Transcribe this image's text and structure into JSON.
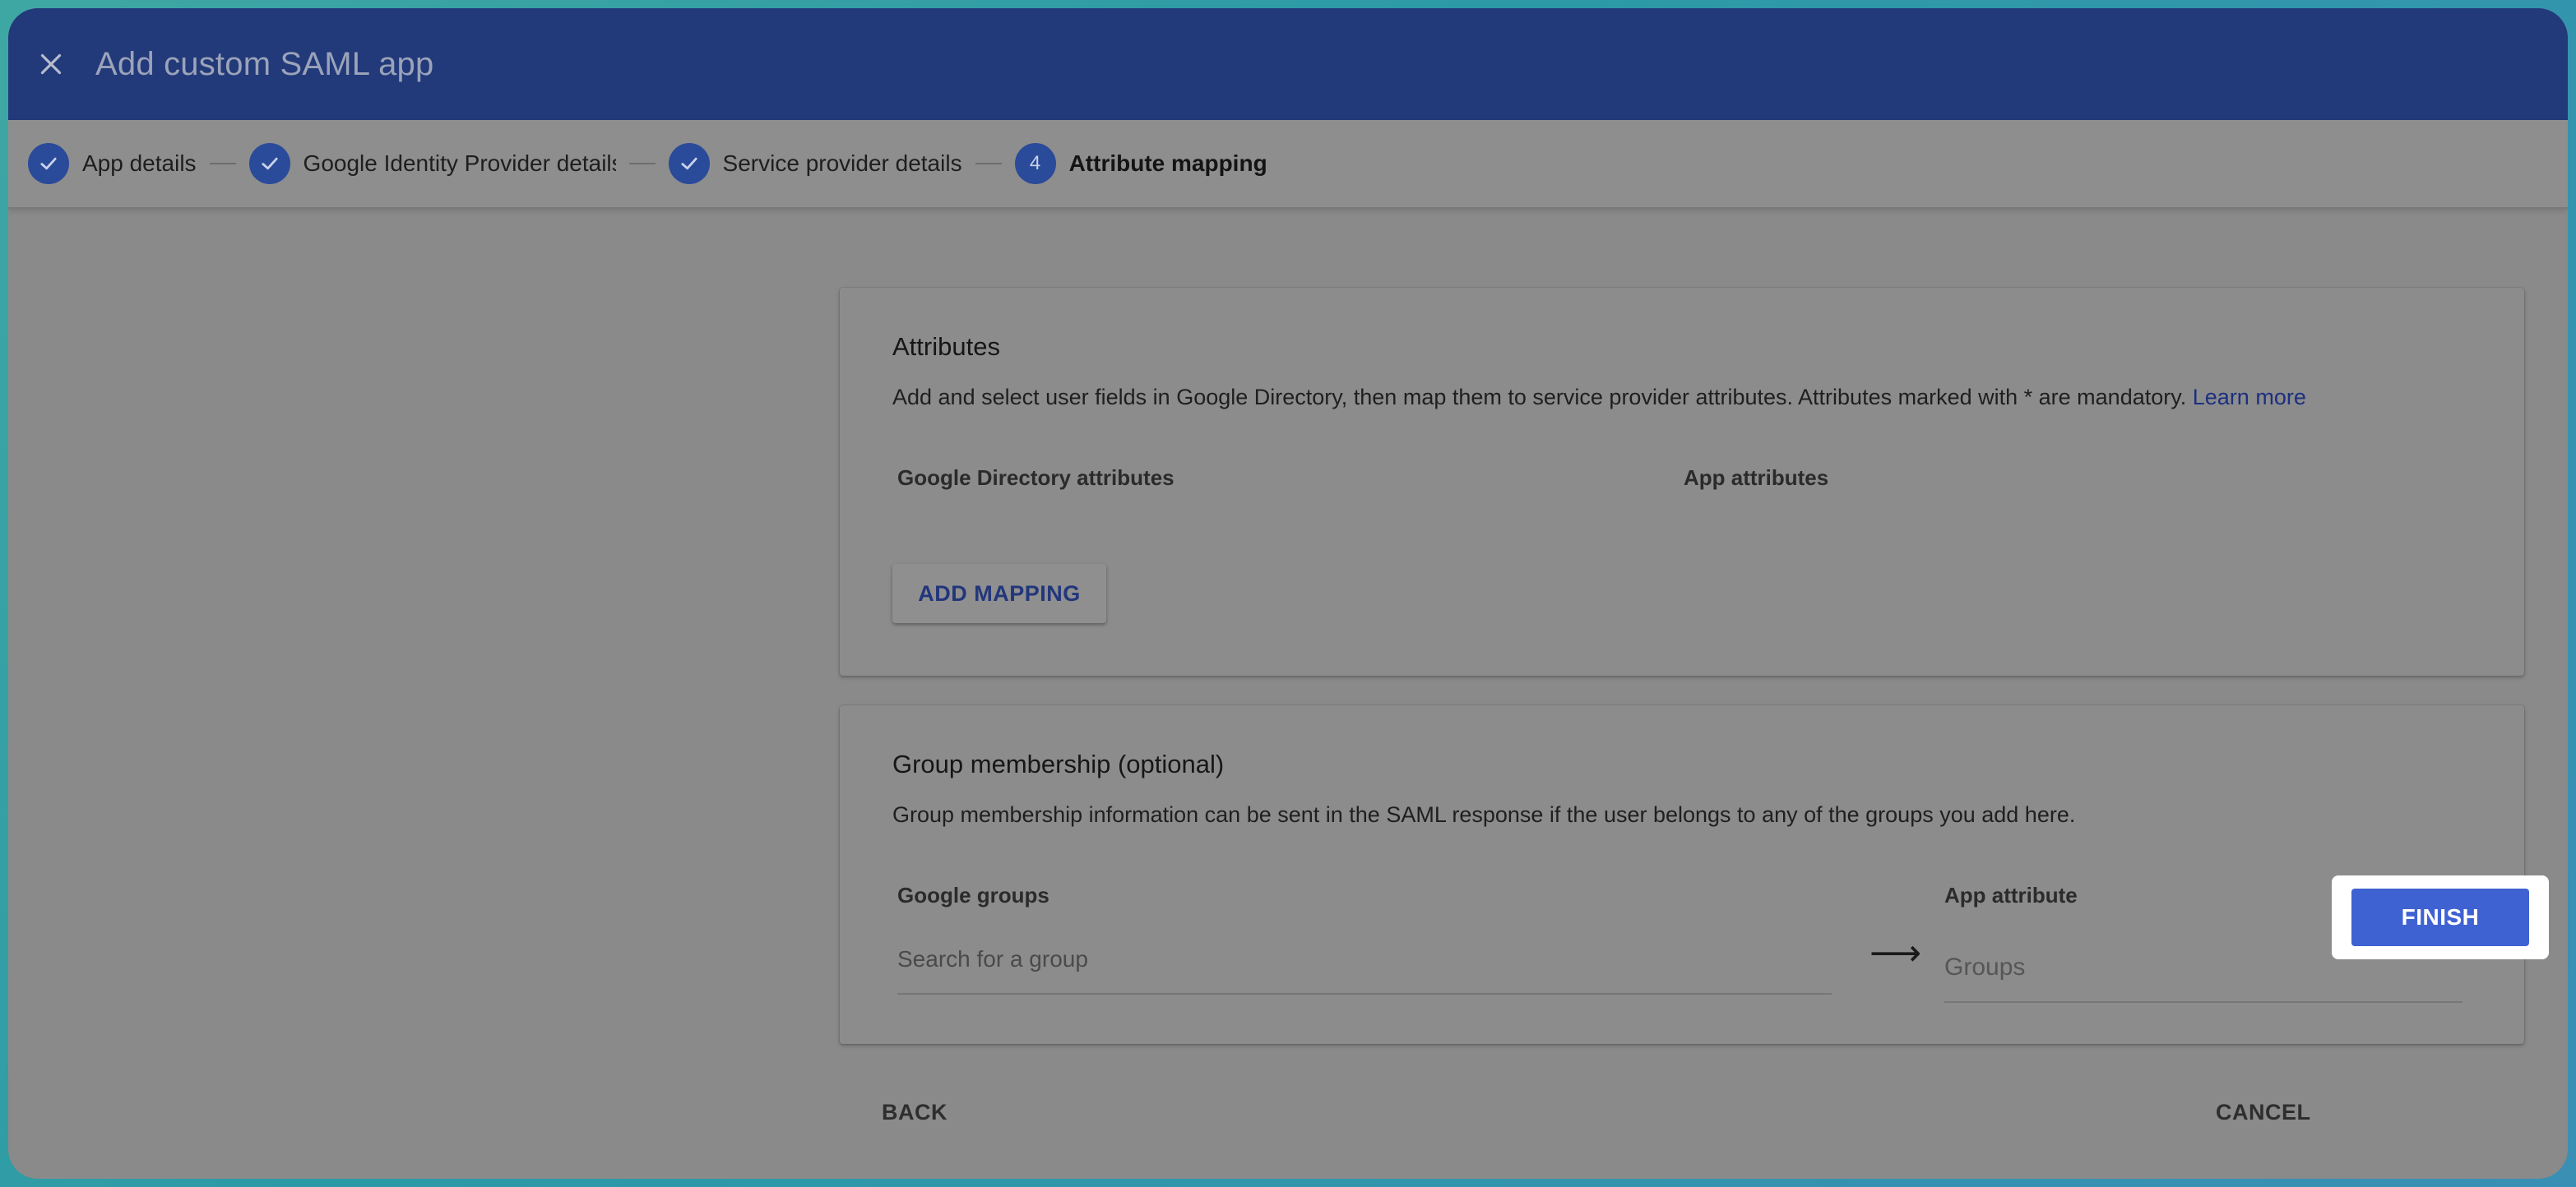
{
  "header": {
    "title": "Add custom SAML app"
  },
  "stepper": {
    "steps": [
      {
        "label": "App details",
        "number": "",
        "state": "done"
      },
      {
        "label": "Google Identity Provider details",
        "number": "",
        "state": "done"
      },
      {
        "label": "Service provider details",
        "number": "",
        "state": "done"
      },
      {
        "label": "Attribute mapping",
        "number": "4",
        "state": "active"
      }
    ]
  },
  "attributes_card": {
    "title": "Attributes",
    "description": "Add and select user fields in Google Directory, then map them to service provider attributes. Attributes marked with * are mandatory.",
    "learn_more": "Learn more",
    "col_directory": "Google Directory attributes",
    "col_app": "App attributes",
    "add_mapping_label": "ADD MAPPING"
  },
  "group_card": {
    "title": "Group membership (optional)",
    "description": "Group membership information can be sent in the SAML response if the user belongs to any of the groups you add here.",
    "col_groups": "Google groups",
    "col_app_attribute": "App attribute",
    "search_placeholder": "Search for a group",
    "app_attribute_placeholder": "Groups",
    "arrow_glyph": "⟶"
  },
  "footer": {
    "back_label": "BACK",
    "cancel_label": "CANCEL",
    "finish_label": "FINISH"
  },
  "colors": {
    "header_bg": "#22397a",
    "accent": "#3f62d2",
    "link": "#1c2f80"
  }
}
